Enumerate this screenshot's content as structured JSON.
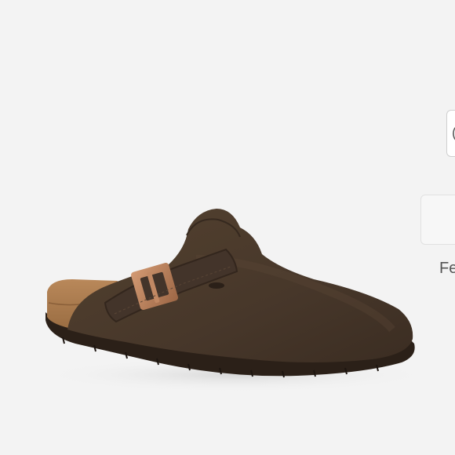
{
  "product": {
    "image_subject": "brown-suede-clog-icon",
    "colors": {
      "background": "#f3f3f3",
      "suede": "#4a3a2a",
      "cork": "#a47748",
      "sole": "#2b2018",
      "buckle": "#b37b56"
    }
  },
  "side_panel": {
    "top_button_glyph": "(",
    "partial_text": "Fe"
  }
}
